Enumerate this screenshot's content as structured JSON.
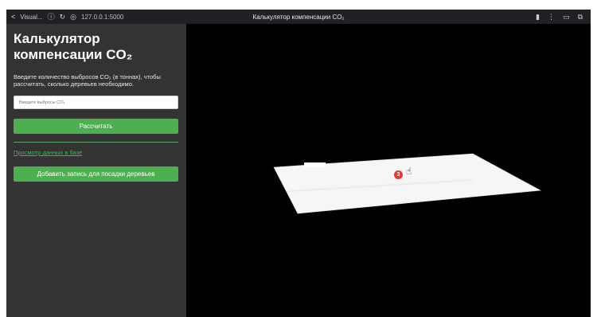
{
  "browser": {
    "tab_label": "Visual...",
    "url": "127.0.0.1:5000",
    "page_title": "Калькулятор компенсации CO₂",
    "back_icon": "back-arrow",
    "reload_icon": "reload",
    "settings_icon": "info-circle"
  },
  "sidebar": {
    "title": "Калькулятор компенсации CO₂",
    "description": "Введите количество выбросов CO₂ (в тоннах), чтобы рассчитать, сколько деревьев необходимо.",
    "input_placeholder": "Введите выбросы CO₂",
    "calculate_label": "Рассчитать",
    "view_data_link": "Просмотр данных в базе",
    "add_record_label": "Добавить запись для посадки деревьев"
  },
  "canvas": {
    "badge_count": "3",
    "accent_color": "#4caf50",
    "badge_color": "#e53935",
    "panel_color": "#333333"
  }
}
